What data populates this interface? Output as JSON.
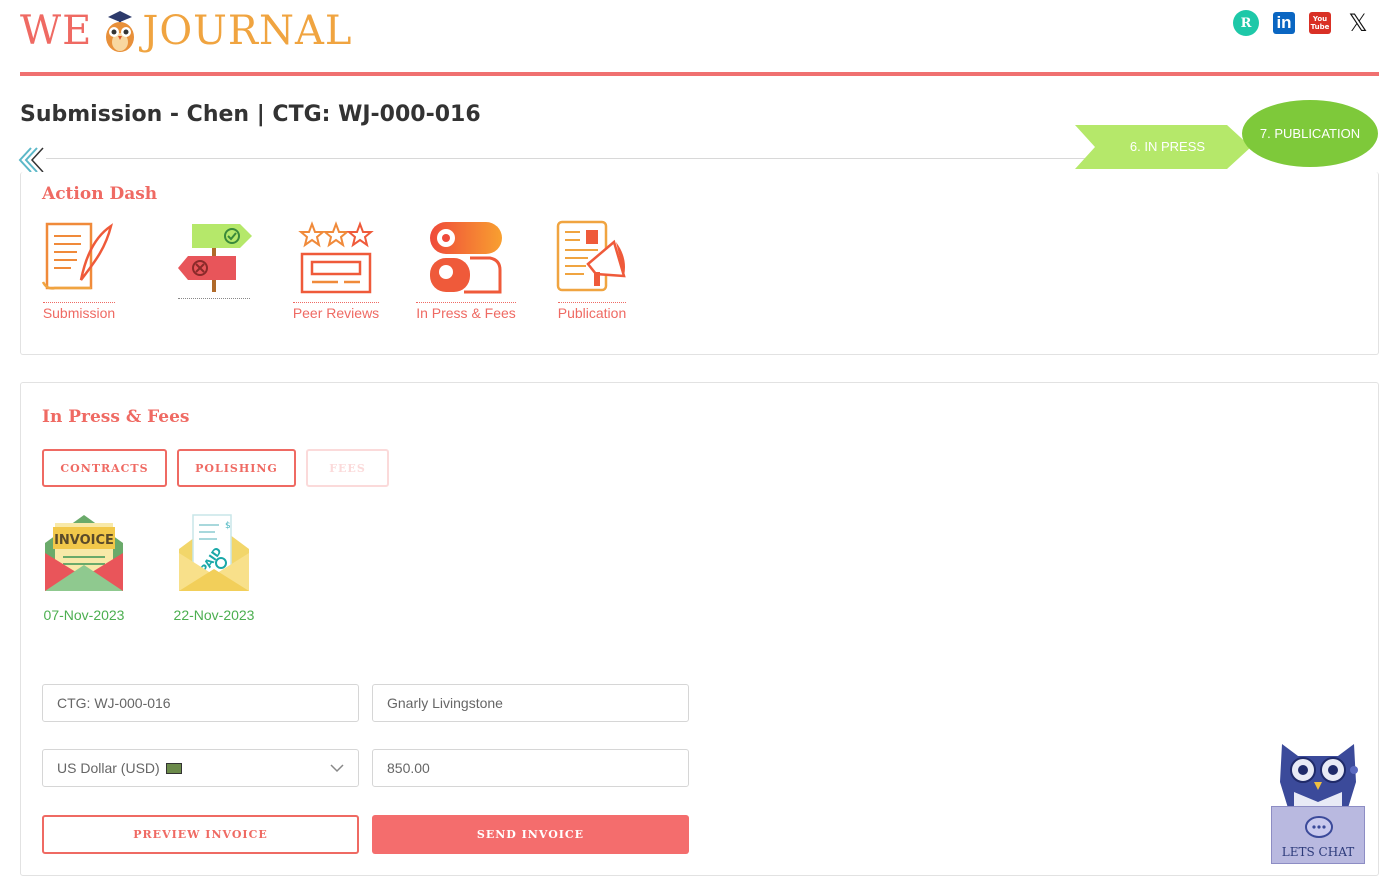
{
  "header": {
    "logo_left": "WE",
    "logo_right": "JOURNAL",
    "socials": [
      {
        "name": "researchgate",
        "label": "R"
      },
      {
        "name": "linkedin",
        "label": "in"
      },
      {
        "name": "youtube",
        "label": "You Tube"
      },
      {
        "name": "x",
        "label": "𝕏"
      }
    ]
  },
  "page": {
    "title": "Submission - Chen | CTG: WJ-000-016"
  },
  "stages": {
    "in_press": "6. IN PRESS",
    "publication": "7. PUBLICATION"
  },
  "action_dash": {
    "title": "Action Dash",
    "items": [
      {
        "label": "Submission"
      },
      {
        "label": ""
      },
      {
        "label": "Peer Reviews"
      },
      {
        "label": "In Press & Fees"
      },
      {
        "label": "Publication"
      }
    ]
  },
  "fees_section": {
    "title": "In Press & Fees",
    "tabs": [
      "CONTRACTS",
      "POLISHING",
      "FEES"
    ],
    "documents": [
      {
        "type": "invoice",
        "date": "07-Nov-2023"
      },
      {
        "type": "paid",
        "date": "22-Nov-2023"
      }
    ],
    "form": {
      "ctg_value": "CTG: WJ-000-016",
      "name_value": "Gnarly Livingstone",
      "currency_value": "US Dollar (USD)",
      "amount_value": "850.00"
    },
    "buttons": {
      "preview": "PREVIEW INVOICE",
      "send": "SEND INVOICE"
    }
  },
  "chat": {
    "label": "LETS CHAT"
  },
  "colors": {
    "accent": "#ef6a63",
    "logo_orange": "#f0a440",
    "stage_light_green": "#b5e86a",
    "stage_green": "#7ec93a",
    "date_green": "#4caf50"
  }
}
